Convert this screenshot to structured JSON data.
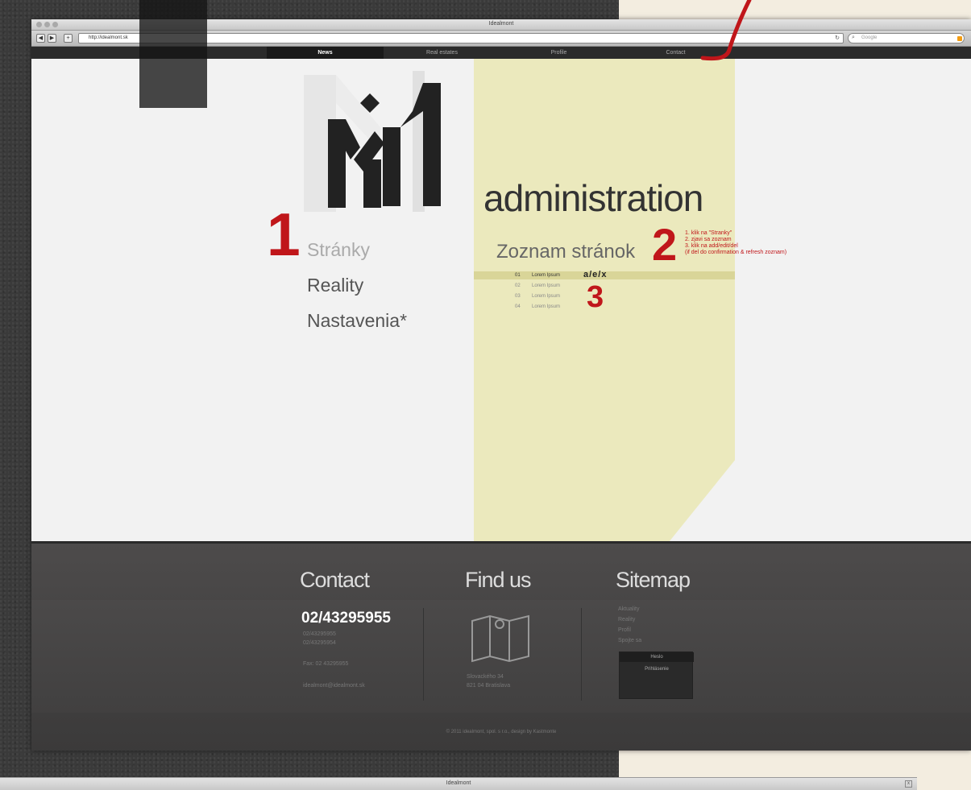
{
  "window": {
    "title": "Idealmont"
  },
  "toolbar": {
    "back": "◀",
    "forward": "▶",
    "url": "http://idealmont.sk",
    "search_placeholder": "Google"
  },
  "nav": {
    "items": [
      {
        "label": "News",
        "active": true
      },
      {
        "label": "Real estates",
        "active": false
      },
      {
        "label": "Profile",
        "active": false
      },
      {
        "label": "Contact",
        "active": false
      }
    ]
  },
  "annotations": {
    "n1": "1",
    "n2": "2",
    "n3": "3"
  },
  "menu": {
    "items": [
      "Stránky",
      "Reality",
      "Nastavenia*"
    ]
  },
  "main": {
    "heading": "administration",
    "subheading": "Zoznam stránok",
    "instructions": [
      "1. klik na \"Stranky\"",
      "2. zjavi sa zoznam",
      "3. klik na add/edit/del",
      "(if del do confirmation & refresh zoznam)"
    ],
    "rows": [
      {
        "idx": "01",
        "label": "Lorem Ipsum"
      },
      {
        "idx": "02",
        "label": "Lorem Ipsum"
      },
      {
        "idx": "03",
        "label": "Lorem Ipsum"
      },
      {
        "idx": "04",
        "label": "Lorem Ipsum"
      }
    ],
    "row_actions": "a/e/x"
  },
  "footer": {
    "contact_title": "Contact",
    "findus_title": "Find us",
    "sitemap_title": "Sitemap",
    "phone": "02/43295955",
    "phone2": "02/43295955",
    "phone3": "02/43295954",
    "fax": "Fax: 02 43295955",
    "email": "idealmont@idealmont.sk",
    "address1": "Slovackého 34",
    "address2": "821 04 Bratislava",
    "sitemap_links": [
      "Aktuality",
      "Reality",
      "Profil",
      "Spojte sa"
    ],
    "sitemap_bar": "Heslo",
    "sitemap_box_label": "Prihlásenie",
    "copyright": "© 2011 idealmont, spol. s r.o., design by Kastmonte"
  },
  "bottom_window": {
    "title": "Idealmont",
    "close": "x"
  }
}
